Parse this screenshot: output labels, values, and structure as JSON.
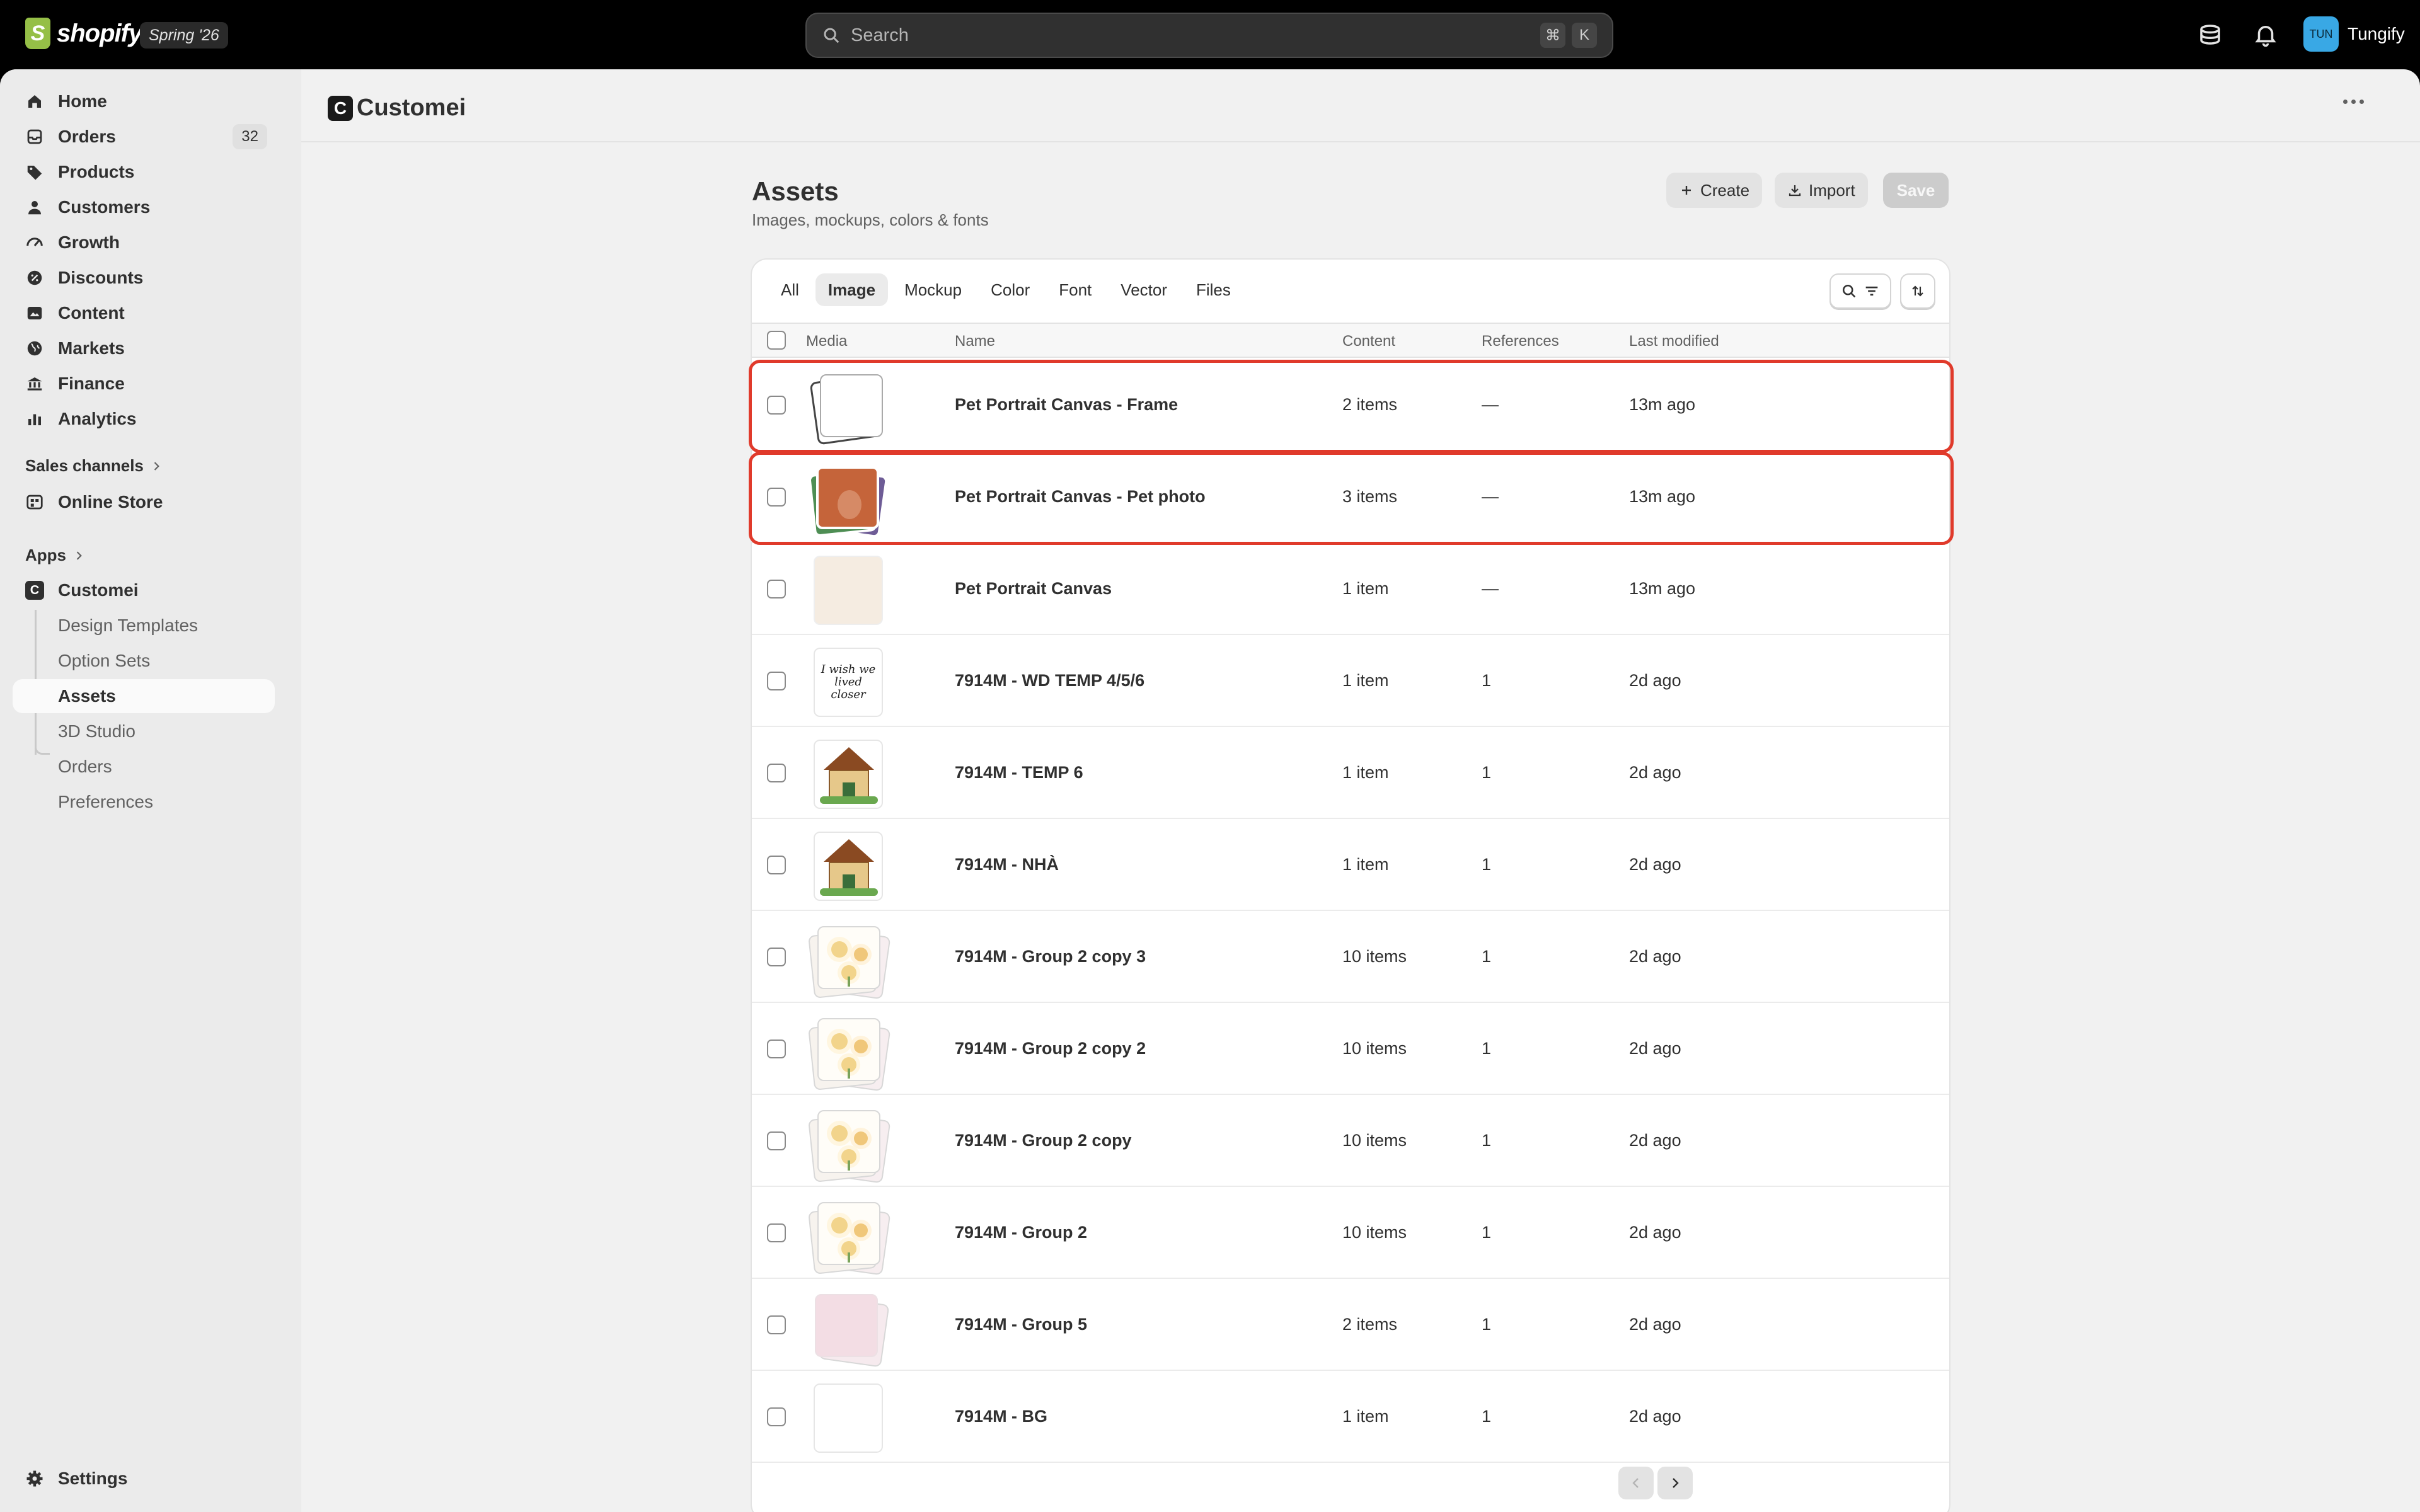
{
  "topbar": {
    "brand": "shopify",
    "version": "Spring '26",
    "search_placeholder": "Search",
    "shortcut_keys": [
      "⌘",
      "K"
    ],
    "user_initials": "TUN",
    "user_name": "Tungify"
  },
  "sidebar": {
    "items": [
      {
        "label": "Home",
        "icon": "home-icon"
      },
      {
        "label": "Orders",
        "icon": "orders-icon",
        "count": "32"
      },
      {
        "label": "Products",
        "icon": "tag-icon"
      },
      {
        "label": "Customers",
        "icon": "person-icon"
      },
      {
        "label": "Growth",
        "icon": "gauge-icon"
      },
      {
        "label": "Discounts",
        "icon": "discount-icon"
      },
      {
        "label": "Content",
        "icon": "content-icon"
      },
      {
        "label": "Markets",
        "icon": "globe-icon"
      },
      {
        "label": "Finance",
        "icon": "bank-icon"
      },
      {
        "label": "Analytics",
        "icon": "bar-chart-icon"
      }
    ],
    "sales_channels_label": "Sales channels",
    "online_store_label": "Online Store",
    "apps_label": "Apps",
    "app_name": "Customei",
    "app_sub_items": [
      "Design Templates",
      "Option Sets",
      "Assets",
      "3D Studio",
      "Orders",
      "Preferences"
    ],
    "settings_label": "Settings"
  },
  "header": {
    "app_logo_letter": "C",
    "app_title": "Customei"
  },
  "page": {
    "title": "Assets",
    "subtitle": "Images, mockups, colors & fonts",
    "buttons": {
      "create": "Create",
      "import": "Import",
      "save": "Save"
    },
    "tabs": [
      "All",
      "Image",
      "Mockup",
      "Color",
      "Font",
      "Vector",
      "Files"
    ],
    "active_tab": "Image",
    "columns": {
      "media": "Media",
      "name": "Name",
      "content": "Content",
      "references": "References",
      "last_modified": "Last modified"
    },
    "rows": [
      {
        "name": "Pet Portrait Canvas - Frame",
        "content": "2 items",
        "references": "—",
        "modified": "13m ago",
        "thumb": "frame"
      },
      {
        "name": "Pet Portrait Canvas - Pet photo",
        "content": "3 items",
        "references": "—",
        "modified": "13m ago",
        "thumb": "pet"
      },
      {
        "name": "Pet Portrait Canvas",
        "content": "1 item",
        "references": "—",
        "modified": "13m ago",
        "thumb": "cream"
      },
      {
        "name": "7914M - WD TEMP 4/5/6",
        "content": "1 item",
        "references": "1",
        "modified": "2d ago",
        "thumb": "script"
      },
      {
        "name": "7914M - TEMP 6",
        "content": "1 item",
        "references": "1",
        "modified": "2d ago",
        "thumb": "house"
      },
      {
        "name": "7914M - NHÀ",
        "content": "1 item",
        "references": "1",
        "modified": "2d ago",
        "thumb": "house"
      },
      {
        "name": "7914M - Group 2 copy 3",
        "content": "10 items",
        "references": "1",
        "modified": "2d ago",
        "thumb": "flowers"
      },
      {
        "name": "7914M - Group 2 copy 2",
        "content": "10 items",
        "references": "1",
        "modified": "2d ago",
        "thumb": "flowers"
      },
      {
        "name": "7914M - Group 2 copy",
        "content": "10 items",
        "references": "1",
        "modified": "2d ago",
        "thumb": "flowers"
      },
      {
        "name": "7914M - Group 2",
        "content": "10 items",
        "references": "1",
        "modified": "2d ago",
        "thumb": "flowers"
      },
      {
        "name": "7914M - Group 5",
        "content": "2 items",
        "references": "1",
        "modified": "2d ago",
        "thumb": "pink"
      },
      {
        "name": "7914M - BG",
        "content": "1 item",
        "references": "1",
        "modified": "2d ago",
        "thumb": "blank"
      }
    ]
  },
  "colors": {
    "highlight": "#e03a2b",
    "accent_avatar": "#39a8e5",
    "shopify_green": "#95bf47"
  }
}
